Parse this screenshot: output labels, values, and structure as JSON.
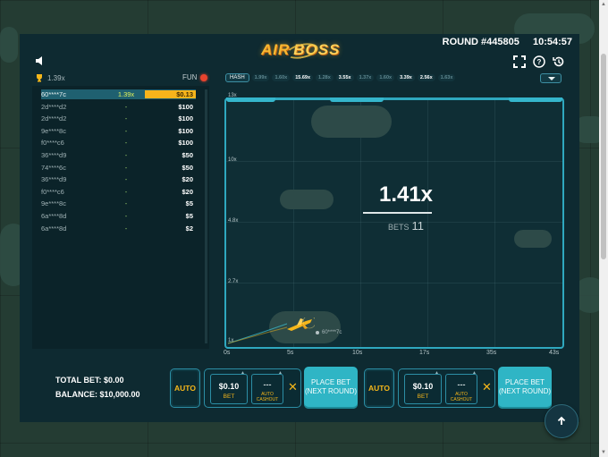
{
  "header": {
    "logo_word1": "AIR",
    "logo_word2": "BOSS",
    "round": "ROUND #445805",
    "time": "10:54:57"
  },
  "sidebar": {
    "top_multiplier": "1.39x",
    "mode": "FUN",
    "bets": [
      {
        "user": "60****7c",
        "mult": "1.39x",
        "amount": "$0.13",
        "won": true
      },
      {
        "user": "2d****d2",
        "mult": "-",
        "amount": "$100",
        "won": false
      },
      {
        "user": "2d****d2",
        "mult": "-",
        "amount": "$100",
        "won": false
      },
      {
        "user": "9e****8c",
        "mult": "-",
        "amount": "$100",
        "won": false
      },
      {
        "user": "f0****c6",
        "mult": "-",
        "amount": "$100",
        "won": false
      },
      {
        "user": "36****d9",
        "mult": "-",
        "amount": "$50",
        "won": false
      },
      {
        "user": "74****6c",
        "mult": "-",
        "amount": "$50",
        "won": false
      },
      {
        "user": "36****d9",
        "mult": "-",
        "amount": "$20",
        "won": false
      },
      {
        "user": "f0****c6",
        "mult": "-",
        "amount": "$20",
        "won": false
      },
      {
        "user": "9e****8c",
        "mult": "-",
        "amount": "$5",
        "won": false
      },
      {
        "user": "6a****8d",
        "mult": "-",
        "amount": "$5",
        "won": false
      },
      {
        "user": "6a****8d",
        "mult": "-",
        "amount": "$2",
        "won": false
      }
    ]
  },
  "history": {
    "hash_label": "HASH",
    "items": [
      {
        "v": "1.99x",
        "hi": false
      },
      {
        "v": "1.60x",
        "hi": false
      },
      {
        "v": "15.69x",
        "hi": true
      },
      {
        "v": "1.28x",
        "hi": false
      },
      {
        "v": "3.55x",
        "hi": true
      },
      {
        "v": "1.37x",
        "hi": false
      },
      {
        "v": "1.60x",
        "hi": false
      },
      {
        "v": "3.39x",
        "hi": true
      },
      {
        "v": "2.56x",
        "hi": true
      },
      {
        "v": "1.63x",
        "hi": false
      }
    ]
  },
  "plot": {
    "y_ticks": [
      "13x",
      "10x",
      "4.8x",
      "2.7x",
      "1x"
    ],
    "x_ticks": [
      "0s",
      "5s",
      "10s",
      "17s",
      "35s",
      "43s"
    ],
    "multiplier": "1.41x",
    "bets_label": "BETS",
    "bets_count": "11",
    "cashout_user": "60****7c"
  },
  "footer": {
    "total_bet": "TOTAL BET: $0.00",
    "balance": "BALANCE: $10,000.00",
    "panels": [
      {
        "auto_label": "AUTO",
        "bet_value": "$0.10",
        "bet_label": "BET",
        "cashout_value": "---",
        "cashout_label": "AUTO CASHOUT",
        "place_label": "PLACE BET (NEXT ROUND)"
      },
      {
        "auto_label": "AUTO",
        "bet_value": "$0.10",
        "bet_label": "BET",
        "cashout_value": "---",
        "cashout_label": "AUTO CASHOUT",
        "place_label": "PLACE BET (NEXT ROUND)"
      }
    ]
  },
  "colors": {
    "accent": "#2fb5c5",
    "gold": "#f6b71a",
    "panel": "#0e2a31",
    "live": "#e8442e"
  },
  "icons": [
    "speaker-icon",
    "trophy-icon",
    "fullscreen-icon",
    "help-icon",
    "history-icon",
    "plane-icon",
    "close-icon",
    "arrow-up-icon",
    "chevron-down-icon"
  ]
}
